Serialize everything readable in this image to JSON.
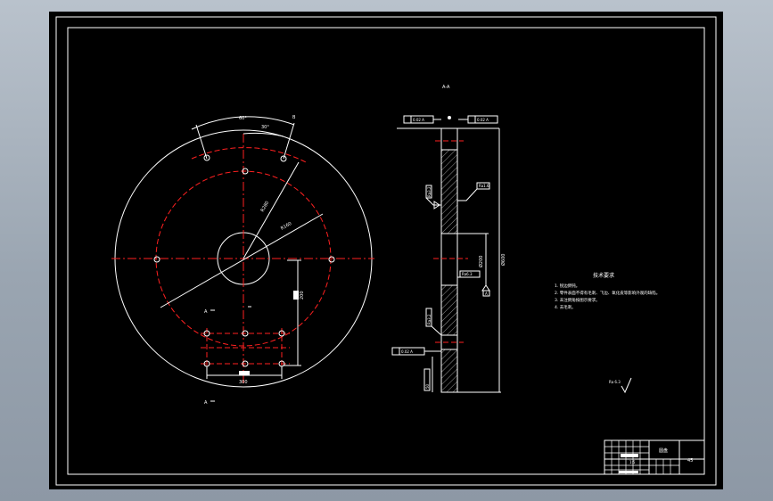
{
  "colors": {
    "background": "#000000",
    "frame": "#ffffff",
    "construction": "#ff2020",
    "dimension": "#ffffff",
    "viewport": "#a0aab5"
  },
  "drawing": {
    "view_label_section": "A-A",
    "view_label_a_top": "A",
    "view_label_a_bottom": "A",
    "view_label_b": "B",
    "dim_angle_outer": "60°",
    "dim_angle_inner": "30°",
    "dim_radius_1": "R280",
    "dim_radius_2": "R160",
    "dim_vertical": "200",
    "dim_horizontal": "300",
    "dim_diameter": "Ø600",
    "dim_bore": "Ø200",
    "gtol_top_left": "0.02 A",
    "gtol_top_right": "0.02 A",
    "gtol_bottom": "0.02 A",
    "datum_a": "A",
    "section_side_label_1": "Ra3.2",
    "section_side_label_2": "Ra1.6",
    "section_side_label_3": "Ra6.3",
    "section_side_label_4": "Ra3.2",
    "section_bottom_dim": "50",
    "surface_finish": "Ra 6.3"
  },
  "notes": {
    "title": "技术要求",
    "items": [
      "1. 锐边倒钝。",
      "2. 零件表面不得有毛刺、飞边、氧化皮等影响外观的缺陷。",
      "3. 未注倒角按图示要求。",
      "4. 去毛刺。"
    ]
  },
  "title_block": {
    "part_name": "圆盘",
    "material": "45",
    "scale": "1:5"
  }
}
